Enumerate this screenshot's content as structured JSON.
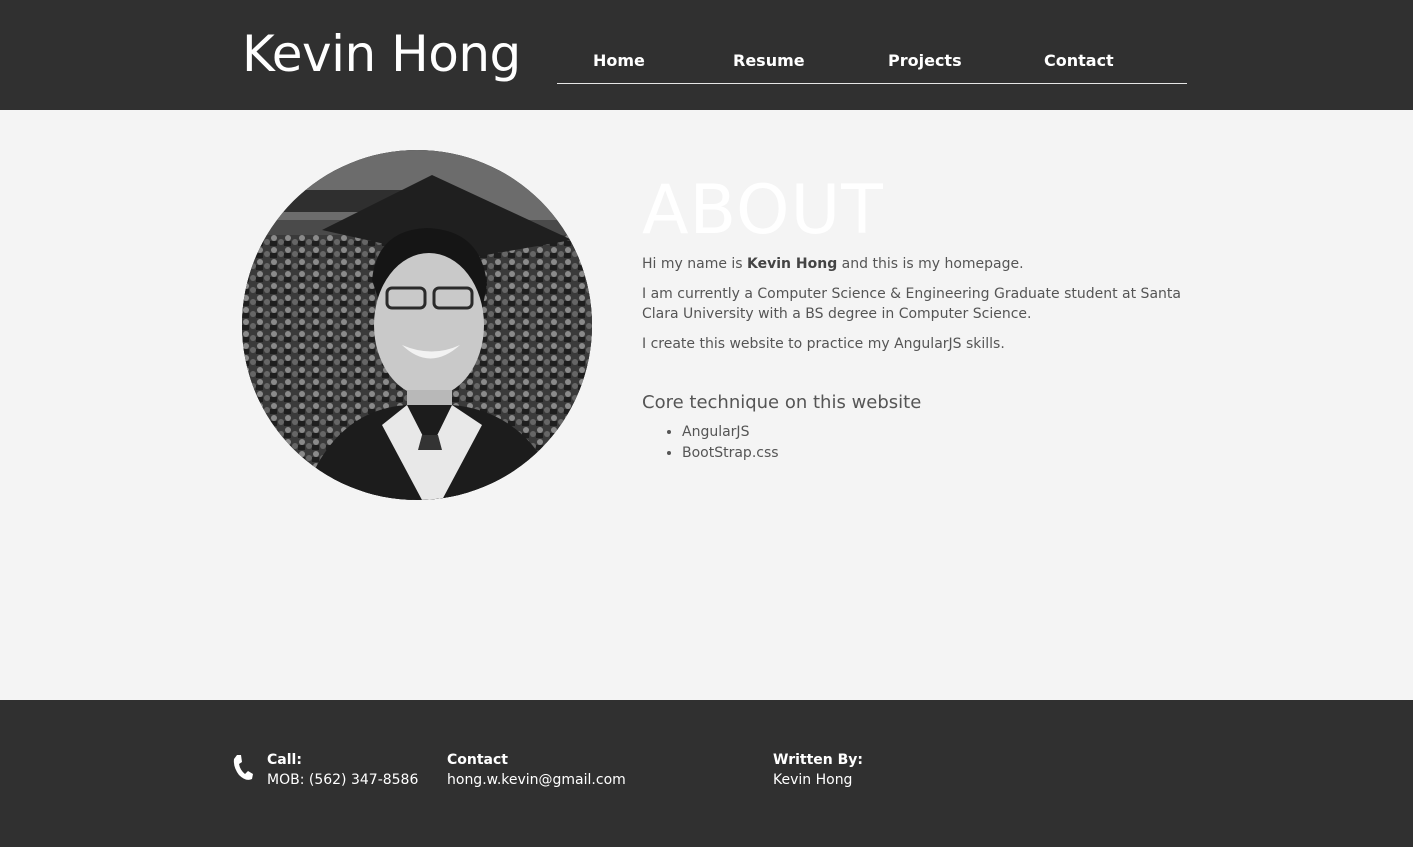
{
  "header": {
    "site_title": "Kevin Hong",
    "nav": [
      {
        "label": "Home"
      },
      {
        "label": "Resume"
      },
      {
        "label": "Projects"
      },
      {
        "label": "Contact"
      }
    ]
  },
  "about": {
    "title": "ABOUT",
    "intro_prefix": "Hi my name is ",
    "intro_name": "Kevin Hong",
    "intro_suffix": " and this is my homepage.",
    "paragraph_2": "I am currently a Computer Science & Engineering Graduate student at Santa Clara University with a BS degree in Computer Science.",
    "paragraph_3": "I create this website to practice my AngularJS skills.",
    "core_title": "Core technique on this website",
    "core_items": [
      "AngularJS",
      "BootStrap.css"
    ]
  },
  "footer": {
    "call_label": "Call:",
    "call_value": "MOB: (562) 347-8586",
    "contact_label": "Contact",
    "contact_value": "hong.w.kevin@gmail.com",
    "written_label": "Written By:",
    "written_value": "Kevin Hong"
  },
  "icons": {
    "phone": "phone-icon"
  },
  "colors": {
    "header_bg": "#303030",
    "body_bg": "#f4f4f4",
    "footer_bg": "#303030",
    "text": "#555555"
  }
}
